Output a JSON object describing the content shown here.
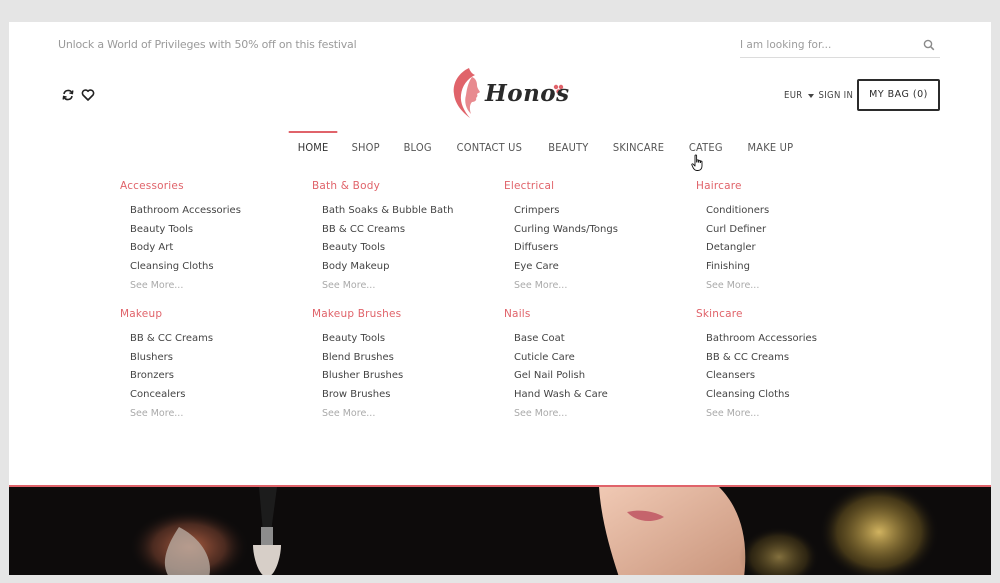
{
  "promo": "Unlock a World of Privileges with 50% off on this festival",
  "search": {
    "placeholder": "I am looking for..."
  },
  "logo": {
    "text": "Honos"
  },
  "currency": {
    "code": "EUR",
    "signin": "SIGN IN"
  },
  "bag": {
    "label": "MY BAG (0)"
  },
  "nav": [
    {
      "label": "HOME",
      "active": true
    },
    {
      "label": "SHOP"
    },
    {
      "label": "BLOG"
    },
    {
      "label": "CONTACT US"
    },
    {
      "label": "BEAUTY"
    },
    {
      "label": "SKINCARE"
    },
    {
      "label": "CATEG"
    },
    {
      "label": "MAKE UP"
    }
  ],
  "mega": [
    {
      "title": "Accessories",
      "items": [
        "Bathroom Accessories",
        "Beauty Tools",
        "Body Art",
        "Cleansing Cloths"
      ],
      "more": "See More..."
    },
    {
      "title": "Bath & Body",
      "items": [
        "Bath Soaks & Bubble Bath",
        "BB & CC Creams",
        "Beauty Tools",
        "Body Makeup"
      ],
      "more": "See More..."
    },
    {
      "title": "Electrical",
      "items": [
        "Crimpers",
        "Curling Wands/Tongs",
        "Diffusers",
        "Eye Care"
      ],
      "more": "See More..."
    },
    {
      "title": "Haircare",
      "items": [
        "Conditioners",
        "Curl Definer",
        "Detangler",
        "Finishing"
      ],
      "more": "See More..."
    },
    {
      "title": "Makeup",
      "items": [
        "BB & CC Creams",
        "Blushers",
        "Bronzers",
        "Concealers"
      ],
      "more": "See More..."
    },
    {
      "title": "Makeup Brushes",
      "items": [
        "Beauty Tools",
        "Blend Brushes",
        "Blusher Brushes",
        "Brow Brushes"
      ],
      "more": "See More..."
    },
    {
      "title": "Nails",
      "items": [
        "Base Coat",
        "Cuticle Care",
        "Gel Nail Polish",
        "Hand Wash & Care"
      ],
      "more": "See More..."
    },
    {
      "title": "Skincare",
      "items": [
        "Bathroom Accessories",
        "BB & CC Creams",
        "Cleansers",
        "Cleansing Cloths"
      ],
      "more": "See More..."
    }
  ],
  "colors": {
    "accent": "#e0636a",
    "text": "#444444",
    "hero_bg": "#0d0b0b"
  }
}
